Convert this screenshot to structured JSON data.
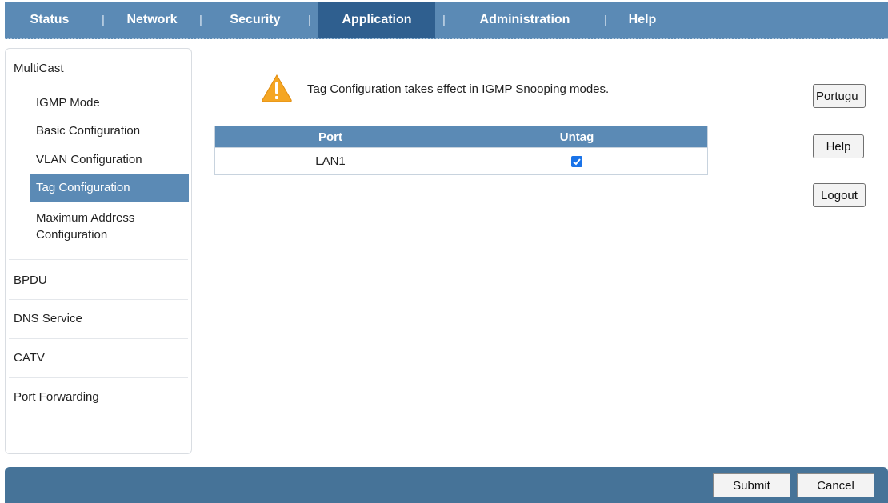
{
  "nav": {
    "tabs": [
      "Status",
      "Network",
      "Security",
      "Application",
      "Administration",
      "Help"
    ],
    "separator": "|",
    "active": "Application"
  },
  "sidebar": {
    "multicast": {
      "title": "MultiCast",
      "items": [
        "IGMP Mode",
        "Basic Configuration",
        "VLAN Configuration",
        "Tag Configuration",
        "Maximum Address Configuration"
      ],
      "active": "Tag Configuration"
    },
    "groups": [
      "BPDU",
      "DNS Service",
      "CATV",
      "Port Forwarding"
    ]
  },
  "notice": {
    "icon": "warning-icon",
    "text": "Tag Configuration takes effect in IGMP Snooping modes."
  },
  "table": {
    "headers": [
      "Port",
      "Untag"
    ],
    "rows": [
      {
        "port": "LAN1",
        "untag": true
      }
    ]
  },
  "side_buttons": {
    "language": "Portugu",
    "help": "Help",
    "logout": "Logout"
  },
  "footer": {
    "submit": "Submit",
    "cancel": "Cancel"
  },
  "colors": {
    "nav_bg": "#5b8ab5",
    "nav_active": "#2f5f8f",
    "footer_bg": "#467398",
    "warning": "#f5a623"
  }
}
